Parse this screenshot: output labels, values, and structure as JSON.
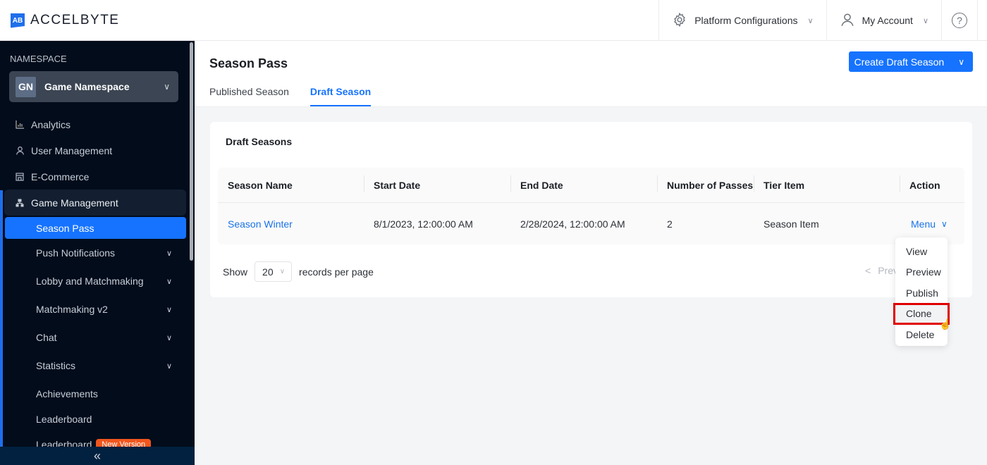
{
  "brand": {
    "logo_mark": "AB",
    "name": "ACCELBYTE",
    "accent": "#1673ff"
  },
  "topnav": {
    "platform_configurations": {
      "label": "Platform Configurations",
      "icon": "gear-icon"
    },
    "my_account": {
      "label": "My Account",
      "icon": "user-icon"
    },
    "help": {
      "icon": "help-icon",
      "glyph": "?"
    }
  },
  "sidebar": {
    "namespace_label": "NAMESPACE",
    "namespace": {
      "initials": "GN",
      "name": "Game Namespace"
    },
    "items": [
      {
        "label": "Analytics",
        "icon": "chart-icon"
      },
      {
        "label": "User Management",
        "icon": "user-icon"
      },
      {
        "label": "E-Commerce",
        "icon": "store-icon"
      },
      {
        "label": "Game Management",
        "icon": "sitemap-icon"
      }
    ],
    "sub_items": [
      {
        "label": "Season Pass",
        "active": true
      },
      {
        "label": "Push Notifications",
        "expandable": true
      },
      {
        "label": "Lobby and Matchmaking",
        "expandable": true
      },
      {
        "label": "Matchmaking v2",
        "expandable": true
      },
      {
        "label": "Chat",
        "expandable": true
      },
      {
        "label": "Statistics",
        "expandable": true
      },
      {
        "label": "Achievements"
      },
      {
        "label": "Leaderboard"
      },
      {
        "label": "Leaderboard",
        "badge": "New Version"
      }
    ],
    "collapse_glyph": "«"
  },
  "page": {
    "title": "Season Pass",
    "create_button": "Create Draft Season",
    "tabs": [
      {
        "label": "Published Season",
        "active": false
      },
      {
        "label": "Draft Season",
        "active": true
      }
    ]
  },
  "card": {
    "title": "Draft Seasons",
    "columns": [
      "Season Name",
      "Start Date",
      "End Date",
      "Number of Passes",
      "Tier Item",
      "Action"
    ],
    "rows": [
      {
        "season_name": "Season Winter",
        "start_date": "8/1/2023, 12:00:00 AM",
        "end_date": "2/28/2024, 12:00:00 AM",
        "number_of_passes": "2",
        "tier_item": "Season Item",
        "action": "Menu"
      }
    ],
    "pager": {
      "show": "Show",
      "per_page": "20",
      "suffix": "records per page",
      "prev": "Prev"
    }
  },
  "action_menu": {
    "items": [
      "View",
      "Preview",
      "Publish",
      "Clone",
      "Delete"
    ],
    "highlighted": "Clone"
  }
}
